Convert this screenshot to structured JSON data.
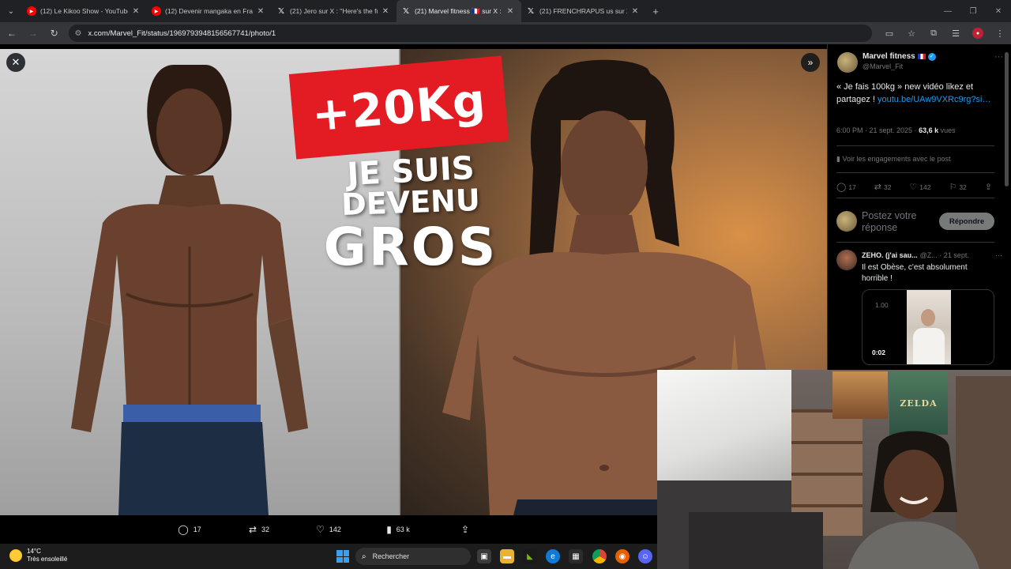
{
  "browser": {
    "tabs": [
      {
        "title": "(12) Le Kikoo Show - YouTube",
        "favicon": "youtube-icon"
      },
      {
        "title": "(12) Devenir mangaka en France",
        "favicon": "youtube-icon"
      },
      {
        "title": "(21) Jero sur X : \"Here's the full",
        "favicon": "x-icon"
      },
      {
        "title": "(21) Marvel fitness 🇫🇷 sur X : « J",
        "favicon": "x-icon",
        "active": true
      },
      {
        "title": "(21) FRENCHRAPUS us sur X : \" J",
        "favicon": "x-icon"
      }
    ],
    "url": "x.com/Marvel_Fit/status/1969793948156567741/photo/1"
  },
  "photo": {
    "headline_badge": "+20Kg",
    "headline_line1": "JE SUIS",
    "headline_line2": "DEVENU",
    "headline_line3": "GROS"
  },
  "photo_actions": {
    "replies": "17",
    "reposts": "32",
    "likes": "142",
    "views": "63 k"
  },
  "post": {
    "author_name": "Marvel fitness",
    "author_handle": "@Marvel_Fit",
    "text": "« Je fais 100kg » new vidéo likez et partagez ! ",
    "link": "youtu.be/UAw9VXRc9rg?si…",
    "timestamp": "6:00 PM · 21 sept. 2025 · ",
    "views_count": "63,6 k",
    "views_label": " vues",
    "engagements_label": "Voir les engagements avec le post",
    "stats": {
      "replies": "17",
      "reposts": "32",
      "likes": "142",
      "bookmarks": "32"
    },
    "reply_placeholder": "Postez votre réponse",
    "reply_button": "Répondre"
  },
  "comment": {
    "author_name": "ZEHO. (j'ai sau...",
    "author_handle": "@Z...",
    "date": "· 21 sept.",
    "text": "Il est Obèse, c'est absolument horrible !",
    "media_rate": "1.00",
    "media_duration": "0:02"
  },
  "webcam": {
    "poster_text": "ZELDA"
  },
  "taskbar": {
    "temperature": "14°C",
    "weather": "Très ensoleillé",
    "search_placeholder": "Rechercher"
  }
}
